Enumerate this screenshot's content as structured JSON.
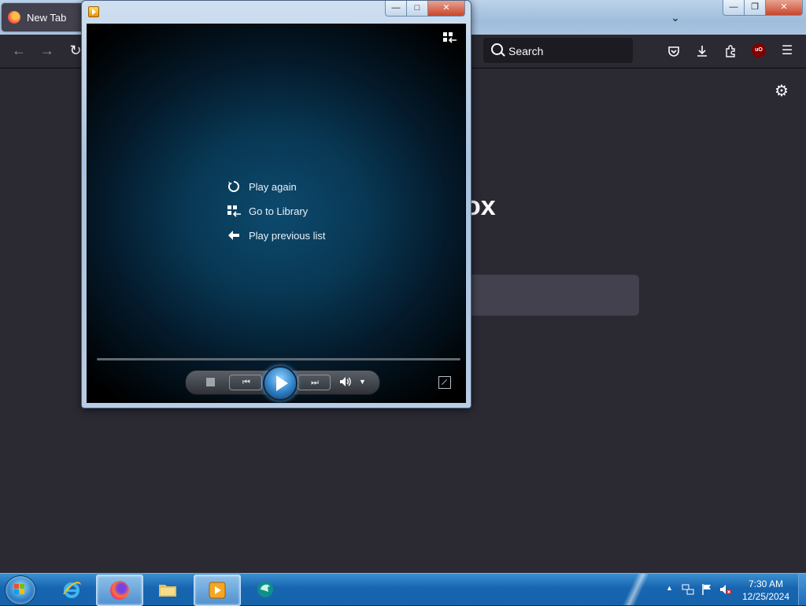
{
  "browser": {
    "tab": {
      "label": "New Tab",
      "icon": "firefox-icon"
    },
    "toolbar": {
      "back_icon": "←",
      "forward_icon": "→",
      "reload_icon": "↻",
      "search_placeholder": "Search",
      "pocket_icon": "pocket-icon",
      "downloads_icon": "download-icon",
      "extensions_icon": "puzzle-icon",
      "ublock_label": "uO",
      "menu_icon": "☰"
    },
    "window_controls": {
      "minimize": "—",
      "maximize": "❐",
      "close": "✕"
    },
    "tab_list_icon": "⌄",
    "content": {
      "wordmark_fragment": "ox",
      "settings_icon": "⚙"
    }
  },
  "media_player": {
    "app_icon": "windows-media-player-icon",
    "window_controls": {
      "minimize": "—",
      "maximize": "□",
      "close": "✕"
    },
    "menu": [
      {
        "label": "Play again",
        "icon": "replay-icon",
        "glyph": "↻"
      },
      {
        "label": "Go to Library",
        "icon": "library-icon",
        "glyph": "▪"
      },
      {
        "label": "Play previous list",
        "icon": "back-arrow-icon",
        "glyph": "⬅"
      }
    ],
    "controls": {
      "stop": "stop-icon",
      "previous": "⏮",
      "play": "play-icon",
      "next": "⏭",
      "volume": "🔈",
      "volume_menu": "▼",
      "fullscreen": "fullscreen-icon",
      "switch_to_library": "switch-to-library-icon"
    },
    "colors": {
      "video_center": "#0d4a6e",
      "play_button": "#2e7fc6"
    }
  },
  "taskbar": {
    "apps": [
      {
        "name": "Internet Explorer",
        "icon": "ie-icon",
        "active": false
      },
      {
        "name": "Firefox",
        "icon": "firefox-icon",
        "active": true
      },
      {
        "name": "Windows Explorer",
        "icon": "folder-icon",
        "active": false
      },
      {
        "name": "Windows Media Player",
        "icon": "wmp-icon",
        "active": true
      },
      {
        "name": "App",
        "icon": "app-icon",
        "active": false
      }
    ],
    "tray": {
      "show_hidden": "▲",
      "network_icon": "network-icon",
      "action_center_icon": "flag-icon",
      "volume_icon": "volume-muted-icon"
    },
    "clock": {
      "time": "7:30 AM",
      "date": "12/25/2024"
    }
  }
}
